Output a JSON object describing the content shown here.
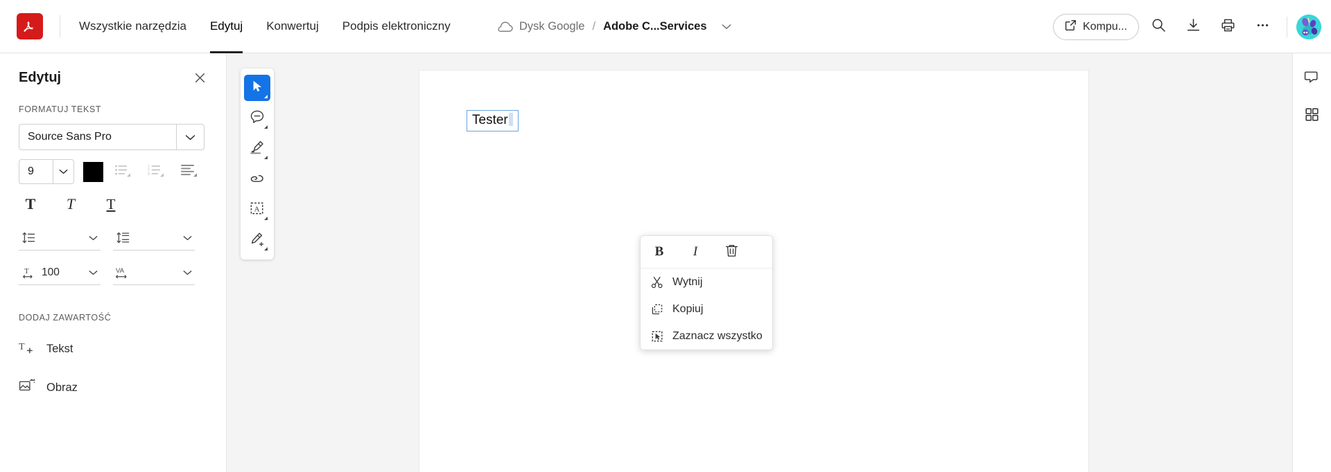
{
  "app": {
    "logo_icon": "acrobat-logo-icon",
    "brand_color": "#d51a1a",
    "accent_color": "#1473e6"
  },
  "topbar": {
    "tabs": [
      {
        "label": "Wszystkie narzędzia",
        "active": false
      },
      {
        "label": "Edytuj",
        "active": true
      },
      {
        "label": "Konwertuj",
        "active": false
      },
      {
        "label": "Podpis elektroniczny",
        "active": false
      }
    ],
    "breadcrumb": {
      "cloud_icon": "cloud-icon",
      "location": "Dysk Google",
      "separator": "/",
      "filename": "Adobe C...Services",
      "caret_icon": "chevron-down-icon"
    },
    "actions": {
      "share_label": "Kompu...",
      "share_icon": "external-link-icon",
      "search_icon": "search-icon",
      "download_icon": "download-icon",
      "print_icon": "print-icon",
      "more_icon": "more-horizontal-icon",
      "avatar_icon": "avatar"
    }
  },
  "left_panel": {
    "title": "Edytuj",
    "close_icon": "close-icon",
    "format_section": {
      "label": "FORMATUJ TEKST",
      "font_family": "Source Sans Pro",
      "font_family_caret": "chevron-down-icon",
      "font_size": "9",
      "font_size_caret": "chevron-down-icon",
      "text_color": "#000000",
      "bullet_list_icon": "bulleted-list-icon",
      "numbered_list_icon": "numbered-list-icon",
      "align_icon": "text-align-icon",
      "bold_icon": "bold-icon",
      "bold_glyph": "T",
      "italic_icon": "italic-icon",
      "italic_glyph": "T",
      "underline_icon": "underline-icon",
      "underline_glyph": "T",
      "line_spacing_icon": "line-spacing-icon",
      "line_spacing_value": "",
      "paragraph_spacing_icon": "paragraph-spacing-icon",
      "paragraph_spacing_value": "",
      "horizontal_scale_icon": "horizontal-scale-icon",
      "horizontal_scale_value": "100",
      "tracking_icon": "letter-spacing-icon",
      "tracking_glyph": "VA",
      "tracking_value": ""
    },
    "add_section": {
      "label": "DODAJ ZAWARTOŚĆ",
      "items": [
        {
          "label": "Tekst",
          "icon": "add-text-icon"
        },
        {
          "label": "Obraz",
          "icon": "add-image-icon"
        }
      ]
    }
  },
  "tool_rail": {
    "tools": [
      {
        "name": "select-tool",
        "icon": "cursor-icon",
        "active": true
      },
      {
        "name": "comment-tool",
        "icon": "comment-icon",
        "active": false
      },
      {
        "name": "highlight-tool",
        "icon": "highlighter-icon",
        "active": false
      },
      {
        "name": "lasso-tool",
        "icon": "lasso-icon",
        "active": false
      },
      {
        "name": "text-box-tool",
        "icon": "text-box-icon",
        "active": false
      },
      {
        "name": "sign-tool",
        "icon": "signature-icon",
        "active": false
      }
    ]
  },
  "document": {
    "textbox_value": "Tester"
  },
  "context_menu": {
    "format_buttons": [
      {
        "label": "B",
        "name": "bold-button",
        "icon": "bold-icon"
      },
      {
        "label": "I",
        "name": "italic-button",
        "icon": "italic-icon"
      },
      {
        "label": "",
        "name": "delete-button",
        "icon": "trash-icon"
      }
    ],
    "items": [
      {
        "label": "Wytnij",
        "icon": "scissors-icon"
      },
      {
        "label": "Kopiuj",
        "icon": "copy-icon"
      },
      {
        "label": "Zaznacz wszystko",
        "icon": "select-all-icon"
      }
    ]
  },
  "right_rail": {
    "buttons": [
      {
        "name": "comments-panel-button",
        "icon": "comment-bubble-icon"
      },
      {
        "name": "thumbnails-panel-button",
        "icon": "grid-icon"
      }
    ]
  }
}
